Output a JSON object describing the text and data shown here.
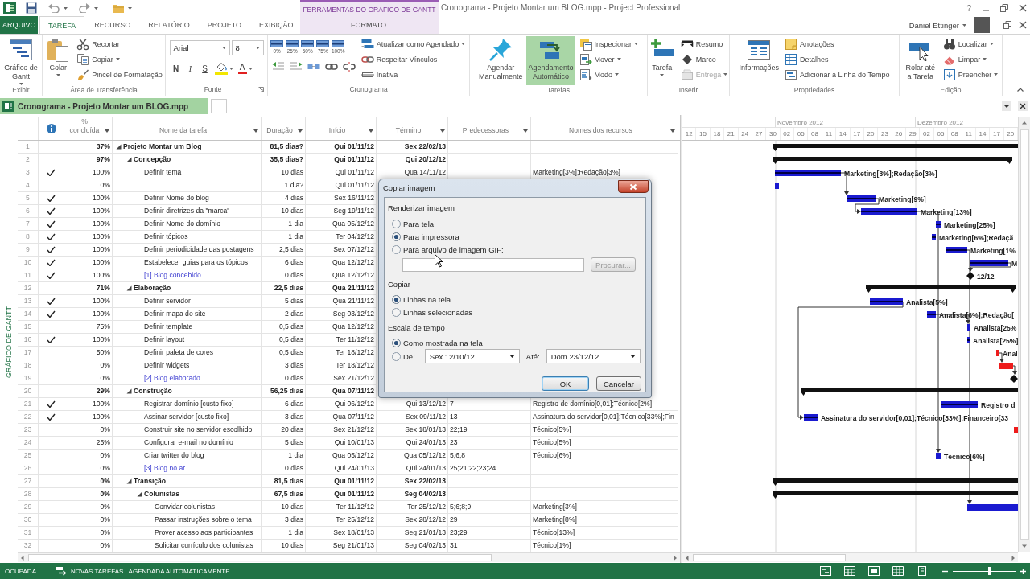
{
  "window": {
    "title": "Cronograma - Projeto Montar um BLOG.mpp - Project Professional",
    "help": "?",
    "contextual_header": "FERRAMENTAS DO GRÁFICO DE GANTT"
  },
  "tabs": [
    {
      "label": "ARQUIVO",
      "kind": "file",
      "selected": false
    },
    {
      "label": "TAREFA",
      "kind": "tab",
      "selected": true
    },
    {
      "label": "RECURSO",
      "kind": "tab",
      "selected": false
    },
    {
      "label": "RELATÓRIO",
      "kind": "tab",
      "selected": false
    },
    {
      "label": "PROJETO",
      "kind": "tab",
      "selected": false
    },
    {
      "label": "EXIBIÇÃO",
      "kind": "tab",
      "selected": false
    },
    {
      "label": "FORMATO",
      "kind": "contextual",
      "selected": false
    }
  ],
  "account": {
    "name": "Daniel Ettinger"
  },
  "ribbon": {
    "groups": [
      {
        "label": "Exibir",
        "launcher": false,
        "columns": [
          [
            [
              {
                "kind": "large",
                "label": "Gráfico de Gantt",
                "dropdown": true
              }
            ]
          ]
        ]
      },
      {
        "label": "Área de Transferência",
        "launcher": false,
        "columns": [
          [
            [
              {
                "kind": "large",
                "label": "Colar",
                "dropdown": true
              }
            ]
          ],
          [
            [
              {
                "kind": "small",
                "label": "Recortar",
                "dropdown": false
              }
            ],
            [
              {
                "kind": "small",
                "label": "Copiar",
                "dropdown": true
              }
            ],
            [
              {
                "kind": "small",
                "label": "Pincel de Formatação",
                "dropdown": false
              }
            ]
          ]
        ]
      },
      {
        "label": "Fonte",
        "launcher": true,
        "columns": [
          [
            [
              {
                "kind": "combo",
                "value": "Arial"
              },
              {
                "kind": "combo",
                "value": "8"
              }
            ],
            [
              {
                "kind": "glyph",
                "label": "N"
              },
              {
                "kind": "glyph",
                "label": "I"
              },
              {
                "kind": "glyph",
                "label": "S"
              },
              {
                "kind": "color-icon",
                "dropdown": true
              },
              {
                "kind": "color-glyph",
                "label": "A",
                "dropdown": true
              }
            ]
          ]
        ]
      },
      {
        "label": "Cronograma",
        "launcher": false,
        "columns": [
          [
            [
              {
                "kind": "percent",
                "label": "0%"
              },
              {
                "kind": "percent",
                "label": "25%"
              },
              {
                "kind": "percent",
                "label": "50%"
              },
              {
                "kind": "percent",
                "label": "75%"
              },
              {
                "kind": "percent",
                "label": "100%"
              }
            ],
            [
              {
                "kind": "icon"
              },
              {
                "kind": "icon"
              },
              {
                "kind": "icon"
              },
              {
                "kind": "icon"
              },
              {
                "kind": "icon"
              }
            ]
          ],
          [
            [
              {
                "kind": "small",
                "label": "Atualizar como Agendado",
                "dropdown": true
              }
            ],
            [
              {
                "kind": "small",
                "label": "Respeitar Vínculos",
                "dropdown": false
              }
            ],
            [
              {
                "kind": "small",
                "label": "Inativa",
                "dropdown": false
              }
            ]
          ]
        ]
      },
      {
        "label": "Tarefas",
        "launcher": false,
        "columns": [
          [
            [
              {
                "kind": "large",
                "label": "Agendar Manualmente",
                "dropdown": false,
                "selected": false
              }
            ]
          ],
          [
            [
              {
                "kind": "large",
                "label": "Agendamento Automático",
                "dropdown": false,
                "selected": true
              }
            ]
          ],
          [
            [
              {
                "kind": "small",
                "label": "Inspecionar",
                "dropdown": true
              }
            ],
            [
              {
                "kind": "small",
                "label": "Mover",
                "dropdown": true
              }
            ],
            [
              {
                "kind": "small",
                "label": "Modo",
                "dropdown": true
              }
            ]
          ]
        ]
      },
      {
        "label": "Inserir",
        "launcher": false,
        "columns": [
          [
            [
              {
                "kind": "large",
                "label": "Tarefa",
                "dropdown": true
              }
            ]
          ],
          [
            [
              {
                "kind": "small",
                "label": "Resumo",
                "dropdown": false,
                "disabled": false
              }
            ],
            [
              {
                "kind": "small",
                "label": "Marco",
                "dropdown": false,
                "disabled": false
              }
            ],
            [
              {
                "kind": "small",
                "label": "Entrega",
                "dropdown": true,
                "disabled": true
              }
            ]
          ]
        ]
      },
      {
        "label": "Propriedades",
        "launcher": false,
        "columns": [
          [
            [
              {
                "kind": "large",
                "label": "Informações",
                "dropdown": false
              }
            ]
          ],
          [
            [
              {
                "kind": "small",
                "label": "Anotações",
                "dropdown": false
              }
            ],
            [
              {
                "kind": "small",
                "label": "Detalhes",
                "dropdown": false
              }
            ],
            [
              {
                "kind": "small",
                "label": "Adicionar à Linha do Tempo",
                "dropdown": false
              }
            ]
          ]
        ]
      },
      {
        "label": "Edição",
        "launcher": false,
        "columns": [
          [
            [
              {
                "kind": "large",
                "label": "Rolar até a Tarefa",
                "dropdown": false
              }
            ]
          ],
          [
            [
              {
                "kind": "small",
                "label": "Localizar",
                "dropdown": true
              }
            ],
            [
              {
                "kind": "small",
                "label": "Limpar",
                "dropdown": true
              }
            ],
            [
              {
                "kind": "small",
                "label": "Preencher",
                "dropdown": true
              }
            ]
          ]
        ]
      }
    ]
  },
  "document_tab": {
    "title": "Cronograma - Projeto Montar um BLOG.mpp"
  },
  "view_label": "GRÁFICO DE GANTT",
  "table": {
    "columns": [
      {
        "kind": "row-number"
      },
      {
        "kind": "indicator"
      },
      {
        "kind": "field",
        "label": "% concluída"
      },
      {
        "kind": "field",
        "label": "Nome da tarefa"
      },
      {
        "kind": "field",
        "label": "Duração"
      },
      {
        "kind": "field",
        "label": "Início"
      },
      {
        "kind": "field",
        "label": "Término"
      },
      {
        "kind": "field",
        "label": "Predecessoras"
      },
      {
        "kind": "field",
        "label": "Nomes dos recursos"
      }
    ],
    "tasks": [
      {
        "id": "1",
        "kind": "summary",
        "expanded": true,
        "completed": false,
        "pct": "37%",
        "name": "Projeto Montar um Blog",
        "duration": "81,5 dias?",
        "start": "Qui 01/11/12",
        "finish": "Sex 22/02/13",
        "bar": {
          "kind": "summary"
        },
        "children": [
          {
            "id": "2",
            "kind": "summary",
            "expanded": true,
            "completed": false,
            "pct": "97%",
            "name": "Concepção",
            "duration": "35,5 dias?",
            "start": "Qui 01/11/12",
            "finish": "Qui 20/12/12",
            "bar": {
              "kind": "summary"
            },
            "children": [
              {
                "id": "3",
                "kind": "task",
                "completed": true,
                "pct": "100%",
                "name": "Definir tema",
                "duration": "10 dias",
                "start": "Qui 01/11/12",
                "finish": "Qua 14/11/12",
                "resources": "Marketing[3%];Redação[3%]",
                "bar": {
                  "kind": "task",
                  "label": "Marketing[3%];Redação[3%]"
                }
              },
              {
                "id": "4",
                "kind": "task",
                "completed": false,
                "pct": "0%",
                "duration": "1 dia?",
                "start": "Qui 01/11/12",
                "bar": {
                  "kind": "task"
                }
              },
              {
                "id": "5",
                "kind": "task",
                "completed": true,
                "pct": "100%",
                "name": "Definir Nome do blog",
                "duration": "4 dias",
                "start": "Sex 16/11/12",
                "bar": {
                  "kind": "task",
                  "label": "Marketing[9%]"
                }
              },
              {
                "id": "6",
                "kind": "task",
                "completed": true,
                "pct": "100%",
                "name": "Definir diretrizes da \"marca\"",
                "duration": "10 dias",
                "start": "Seg 19/11/12",
                "bar": {
                  "kind": "task",
                  "label": "Marketing[13%]"
                }
              },
              {
                "id": "7",
                "kind": "task",
                "completed": true,
                "pct": "100%",
                "name": "Definir Nome do domínio",
                "duration": "1 dia",
                "start": "Qua 05/12/12",
                "bar": {
                  "kind": "task",
                  "label": "Marketing[25%]"
                }
              },
              {
                "id": "8",
                "kind": "task",
                "completed": true,
                "pct": "100%",
                "name": "Definir tópicos",
                "duration": "1 dia",
                "start": "Ter 04/12/12",
                "bar": {
                  "kind": "task",
                  "label": "Marketing[6%];Redaçã"
                }
              },
              {
                "id": "9",
                "kind": "task",
                "completed": true,
                "pct": "100%",
                "name": "Definir periodicidade das postagens",
                "duration": "2,5 dias",
                "start": "Sex 07/12/12",
                "bar": {
                  "kind": "task",
                  "label": "Marketing[1%"
                }
              },
              {
                "id": "10",
                "kind": "task",
                "completed": true,
                "pct": "100%",
                "name": "Estabelecer guias para os tópicos",
                "duration": "6 dias",
                "start": "Qua 12/12/12",
                "bar": {
                  "kind": "task",
                  "label": "M"
                }
              },
              {
                "id": "11",
                "kind": "milestone",
                "completed": true,
                "pct": "100%",
                "name": "[1] Blog concebido",
                "duration": "0 dias",
                "start": "Qua 12/12/12",
                "bar": {
                  "kind": "milestone",
                  "label": "12/12"
                }
              }
            ]
          },
          {
            "id": "12",
            "kind": "summary",
            "expanded": true,
            "completed": false,
            "pct": "71%",
            "name": "Elaboração",
            "duration": "22,5 dias",
            "start": "Qua 21/11/12",
            "bar": {
              "kind": "summary"
            },
            "children": [
              {
                "id": "13",
                "kind": "task",
                "completed": true,
                "pct": "100%",
                "name": "Definir servidor",
                "duration": "5 dias",
                "start": "Qua 21/11/12",
                "bar": {
                  "kind": "task",
                  "label": "Analista[5%]"
                }
              },
              {
                "id": "14",
                "kind": "task",
                "completed": true,
                "pct": "100%",
                "name": "Definir mapa do site",
                "duration": "2 dias",
                "start": "Seg 03/12/12",
                "bar": {
                  "kind": "task",
                  "label": "Analista[6%];Redação["
                }
              },
              {
                "id": "15",
                "kind": "task",
                "completed": false,
                "pct": "75%",
                "name": "Definir template",
                "duration": "0,5 dias",
                "start": "Qua 12/12/12",
                "bar": {
                  "kind": "task",
                  "label": "Analista[25%"
                }
              },
              {
                "id": "16",
                "kind": "task",
                "completed": true,
                "pct": "100%",
                "name": "Definir layout",
                "duration": "0,5 dias",
                "start": "Ter 11/12/12",
                "bar": {
                  "kind": "task",
                  "label": "Analista[25%]"
                }
              },
              {
                "id": "17",
                "kind": "task",
                "completed": false,
                "pct": "50%",
                "name": "Definir paleta de cores",
                "duration": "0,5 dias",
                "start": "Ter 18/12/12",
                "bar": {
                  "kind": "critical",
                  "label": "Anal"
                }
              },
              {
                "id": "18",
                "kind": "task",
                "completed": false,
                "pct": "0%",
                "name": "Definir widgets",
                "duration": "3 dias",
                "start": "Ter 18/12/12",
                "bar": {
                  "kind": "critical"
                }
              },
              {
                "id": "19",
                "kind": "milestone",
                "completed": false,
                "pct": "0%",
                "name": "[2] Blog elaborado",
                "duration": "0 dias",
                "start": "Sex 21/12/12",
                "bar": {
                  "kind": "milestone"
                }
              }
            ]
          },
          {
            "id": "20",
            "kind": "summary",
            "expanded": true,
            "completed": false,
            "pct": "29%",
            "name": "Construção",
            "duration": "56,25 dias",
            "start": "Qua 07/11/12",
            "bar": {
              "kind": "summary"
            },
            "children": [
              {
                "id": "21",
                "kind": "task",
                "completed": true,
                "pct": "100%",
                "name": "Registrar domínio [custo fixo]",
                "duration": "6 dias",
                "start": "Qui 06/12/12",
                "finish": "Qui 13/12/12",
                "predecessors": "7",
                "resources": "Registro de domínio[0,01];Técnico[2%]",
                "bar": {
                  "kind": "task",
                  "label": "Registro d"
                }
              },
              {
                "id": "22",
                "kind": "task",
                "completed": true,
                "pct": "100%",
                "name": "Assinar servidor [custo fixo]",
                "duration": "3 dias",
                "start": "Qua 07/11/12",
                "finish": "Sex 09/11/12",
                "predecessors": "13",
                "resources": "Assinatura do servidor[0,01];Técnico[33%];Fin",
                "bar": {
                  "kind": "task",
                  "label": "Assinatura do servidor[0,01];Técnico[33%];Financeiro[33"
                }
              },
              {
                "id": "23",
                "kind": "task",
                "completed": false,
                "pct": "0%",
                "name": "Construir site no servidor escolhido",
                "duration": "20 dias",
                "start": "Sex 21/12/12",
                "finish": "Sex 18/01/13",
                "predecessors": "22;19",
                "resources": "Técnico[5%]",
                "bar": {
                  "kind": "critical"
                }
              },
              {
                "id": "24",
                "kind": "task",
                "completed": false,
                "pct": "25%",
                "name": "Configurar e-mail no domínio",
                "duration": "5 dias",
                "start": "Qui 10/01/13",
                "finish": "Qui 24/01/13",
                "predecessors": "23",
                "resources": "Técnico[5%]"
              },
              {
                "id": "25",
                "kind": "task",
                "completed": false,
                "pct": "0%",
                "name": "Criar twitter do blog",
                "duration": "1 dia",
                "start": "Qua 05/12/12",
                "finish": "Qua 05/12/12",
                "predecessors": "5;6;8",
                "resources": "Técnico[6%]",
                "bar": {
                  "kind": "task",
                  "label": "Técnico[6%]"
                }
              },
              {
                "id": "26",
                "kind": "milestone",
                "completed": false,
                "pct": "0%",
                "name": "[3] Blog no ar",
                "duration": "0 dias",
                "start": "Qui 24/01/13",
                "finish": "Qui 24/01/13",
                "predecessors": "25;21;22;23;24"
              }
            ]
          },
          {
            "id": "27",
            "kind": "summary",
            "expanded": true,
            "completed": false,
            "pct": "0%",
            "name": "Transição",
            "duration": "81,5 dias",
            "start": "Qui 01/11/12",
            "finish": "Sex 22/02/13",
            "bar": {
              "kind": "summary"
            },
            "children": [
              {
                "id": "28",
                "kind": "summary",
                "expanded": true,
                "completed": false,
                "pct": "0%",
                "name": "Colunistas",
                "duration": "67,5 dias",
                "start": "Qui 01/11/12",
                "finish": "Seg 04/02/13",
                "bar": {
                  "kind": "summary"
                },
                "children": [
                  {
                    "id": "29",
                    "kind": "task",
                    "completed": false,
                    "pct": "0%",
                    "name": "Convidar colunistas",
                    "duration": "10 dias",
                    "start": "Ter 11/12/12",
                    "finish": "Ter 25/12/12",
                    "predecessors": "5;6;8;9",
                    "resources": "Marketing[3%]",
                    "bar": {
                      "kind": "task"
                    }
                  },
                  {
                    "id": "30",
                    "kind": "task",
                    "completed": false,
                    "pct": "0%",
                    "name": "Passar instruções sobre o tema",
                    "duration": "3 dias",
                    "start": "Ter 25/12/12",
                    "finish": "Sex 28/12/12",
                    "predecessors": "29",
                    "resources": "Marketing[8%]"
                  },
                  {
                    "id": "31",
                    "kind": "task",
                    "completed": false,
                    "pct": "0%",
                    "name": "Prover acesso aos participantes",
                    "duration": "1 dia",
                    "start": "Sex 18/01/13",
                    "finish": "Seg 21/01/13",
                    "predecessors": "23;29",
                    "resources": "Técnico[13%]"
                  },
                  {
                    "id": "32",
                    "kind": "task",
                    "completed": false,
                    "pct": "0%",
                    "name": "Solicitar currículo dos colunistas",
                    "duration": "10 dias",
                    "start": "Seg 21/01/13",
                    "finish": "Seg 04/02/13",
                    "predecessors": "31",
                    "resources": "Técnico[1%]"
                  }
                ]
              }
            ]
          }
        ]
      }
    ]
  },
  "gantt": {
    "timescale": {
      "months": [
        "Novembro 2012",
        "Dezembro 2012"
      ],
      "days": [
        "12",
        "15",
        "18",
        "21",
        "24",
        "27",
        "30",
        "02",
        "05",
        "08",
        "11",
        "14",
        "17",
        "20",
        "23",
        "26",
        "29",
        "02",
        "05",
        "08",
        "11",
        "14",
        "17",
        "20"
      ]
    }
  },
  "dialog": {
    "title": "Copiar imagem",
    "sections": [
      {
        "heading": "Renderizar imagem",
        "options": [
          {
            "label": "Para tela",
            "selected": false
          },
          {
            "label": "Para impressora",
            "selected": true
          },
          {
            "label": "Para arquivo de imagem GIF:",
            "selected": false
          }
        ],
        "file": {
          "browse": {
            "label": "Procurar...",
            "disabled": true
          }
        }
      },
      {
        "heading": "Copiar",
        "options": [
          {
            "label": "Linhas na tela",
            "selected": true
          },
          {
            "label": "Linhas selecionadas",
            "selected": false
          }
        ]
      },
      {
        "heading": "Escala de tempo",
        "options": [
          {
            "label": "Como mostrada na tela",
            "selected": true
          },
          {
            "label": "De:",
            "selected": false,
            "from": "Sex 12/10/12",
            "to_label": "Até:",
            "to": "Dom 23/12/12"
          }
        ]
      }
    ],
    "buttons": [
      {
        "label": "OK",
        "default": true
      },
      {
        "label": "Cancelar",
        "default": false
      }
    ]
  },
  "status_bar": {
    "mode": "OCUPADA",
    "new_tasks": "NOVAS TAREFAS : AGENDADA AUTOMATICAMENTE",
    "zoom": {
      "level": 0.58
    }
  }
}
